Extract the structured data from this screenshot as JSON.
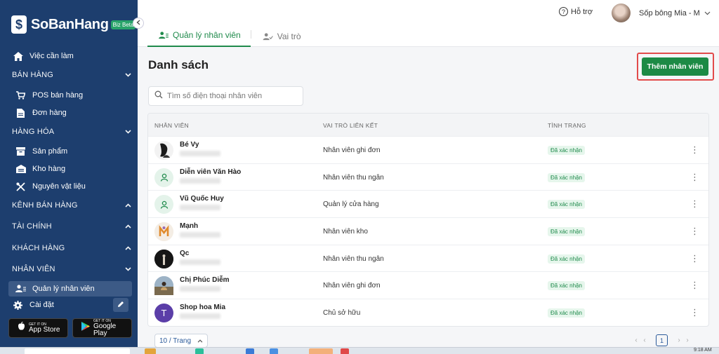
{
  "brand": {
    "name": "SoBanHang",
    "badge": "Biz Beta",
    "logo_char": "$"
  },
  "sidebar": {
    "items": [
      {
        "key": "todo",
        "label": "Việc cần làm",
        "icon": "home-icon"
      },
      {
        "key": "pos",
        "label": "POS bán hàng",
        "icon": "cart-icon"
      },
      {
        "key": "orders",
        "label": "Đơn hàng",
        "icon": "document-icon"
      },
      {
        "key": "products",
        "label": "Sản phẩm",
        "icon": "box-icon"
      },
      {
        "key": "warehouse",
        "label": "Kho hàng",
        "icon": "warehouse-icon"
      },
      {
        "key": "materials",
        "label": "Nguyên vật liệu",
        "icon": "utensils-icon"
      },
      {
        "key": "staff-mgmt",
        "label": "Quản lý nhân viên",
        "icon": "users-icon"
      },
      {
        "key": "settings",
        "label": "Cài đặt",
        "icon": "gear-icon"
      }
    ],
    "sections": [
      {
        "key": "sales",
        "label": "BÁN HÀNG",
        "expanded": true
      },
      {
        "key": "goods",
        "label": "HÀNG HÓA",
        "expanded": true
      },
      {
        "key": "channels",
        "label": "KÊNH BÁN HÀNG",
        "expanded": false
      },
      {
        "key": "finance",
        "label": "TÀI CHÍNH",
        "expanded": false
      },
      {
        "key": "customers",
        "label": "KHÁCH HÀNG",
        "expanded": false
      },
      {
        "key": "staff",
        "label": "NHÂN VIÊN",
        "expanded": true
      }
    ],
    "appstore": {
      "small": "GET IT ON",
      "big": "App Store"
    },
    "googleplay": {
      "small": "GET IT ON",
      "big": "Google Play"
    }
  },
  "header": {
    "help": "Hỗ trợ",
    "user_name": "Sốp bông Mia - M",
    "tabs": [
      {
        "label": "Quản lý nhân viên",
        "active": true
      },
      {
        "label": "Vai trò",
        "active": false
      }
    ]
  },
  "main": {
    "title": "Danh sách",
    "add_button": "Thêm nhân viên",
    "search_placeholder": "Tìm số điện thoại nhân viên",
    "columns": [
      "NHÂN VIÊN",
      "VAI TRÒ LIÊN KẾT",
      "TÌNH TRẠNG"
    ],
    "rows": [
      {
        "name": "Bé Vy",
        "role": "Nhân viên ghi đơn",
        "status": "Đã xác nhận",
        "avatar": "photo-dark"
      },
      {
        "name": "Diễn viên Văn Hào",
        "role": "Nhân viên thu ngân",
        "status": "Đã xác nhận",
        "avatar": "default"
      },
      {
        "name": "Vũ Quốc Huy",
        "role": "Quản lý cửa hàng",
        "status": "Đã xác nhận",
        "avatar": "default"
      },
      {
        "name": "Mạnh",
        "role": "Nhân viên kho",
        "status": "Đã xác nhận",
        "avatar": "logo-m"
      },
      {
        "name": "Qc",
        "role": "Nhân viên thu ngân",
        "status": "Đã xác nhận",
        "avatar": "photo-night"
      },
      {
        "name": "Chị Phúc Diễm",
        "role": "Nhân viên ghi đơn",
        "status": "Đã xác nhận",
        "avatar": "photo-outdoor"
      },
      {
        "name": "Shop hoa Mia",
        "role": "Chủ sở hữu",
        "status": "Đã xác nhận",
        "avatar": "letter",
        "letter": "T"
      }
    ],
    "page_size": "10 / Trang",
    "current_page": "1"
  },
  "taskbar": {
    "clock": "9:18 AM"
  },
  "colors": {
    "sidebar": "#1d3e6e",
    "accent": "#1c8a45",
    "highlight": "#e24b4b"
  }
}
